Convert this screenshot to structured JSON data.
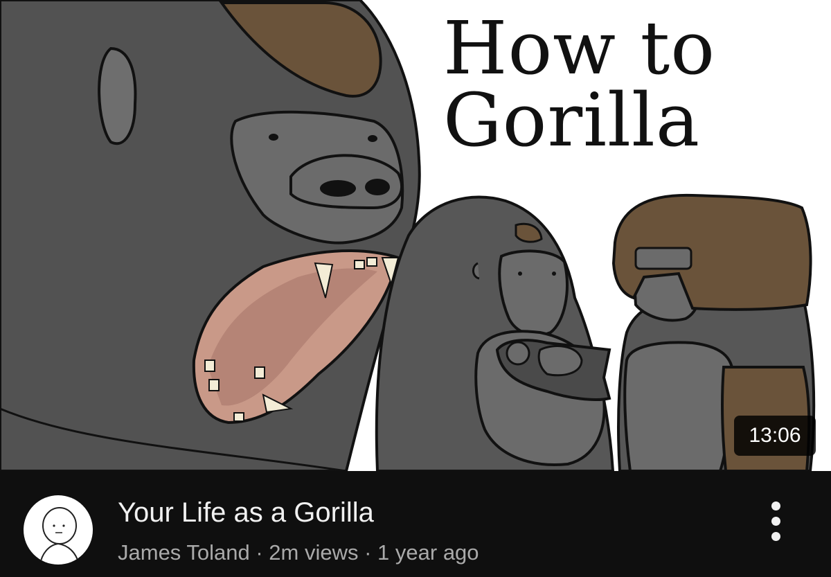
{
  "thumbnail": {
    "title_line1": "How to",
    "title_line2": "Gorilla",
    "duration": "13:06",
    "colors": {
      "gorilla_dark": "#505050",
      "gorilla_face": "#6b6b6b",
      "mouth": "#c99988",
      "brown": "#6a533a",
      "background": "#ffffff"
    }
  },
  "video": {
    "title": "Your Life as a Gorilla",
    "channel": "James Toland",
    "separator": " · ",
    "views": "2m views",
    "age": "1 year ago"
  },
  "icons": {
    "avatar": "stick-figure-avatar",
    "more": "vertical-ellipsis-icon"
  }
}
